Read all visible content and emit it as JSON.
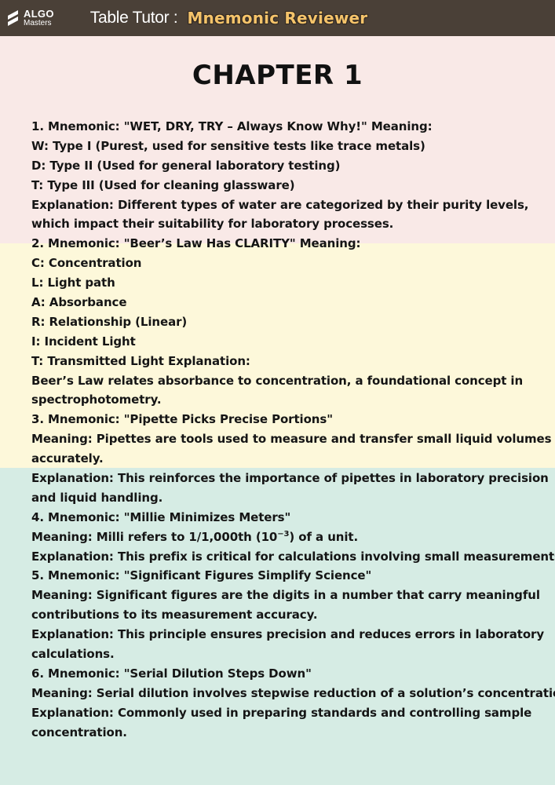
{
  "header": {
    "logo_word": "ALGO",
    "logo_sub": "Masters",
    "title_plain": "Table Tutor :",
    "title_accent": "Mnemonic Reviewer"
  },
  "chapter_title": "CHAPTER 1",
  "lines": [
    "1. Mnemonic: \"WET, DRY, TRY – Always Know Why!\" Meaning:",
    "W: Type I (Purest, used for sensitive tests like trace metals)",
    "D: Type II (Used for general laboratory testing)",
    "T: Type III (Used for cleaning glassware)",
    "Explanation: Different types of water are categorized by their purity levels,",
    "which impact their suitability for laboratory processes.",
    "2. Mnemonic: \"Beer’s Law Has CLARITY\" Meaning:",
    "C: Concentration",
    "L: Light path",
    "A: Absorbance",
    "R: Relationship (Linear)",
    "I: Incident Light",
    "T: Transmitted Light Explanation:",
    "Beer’s Law relates absorbance to concentration, a foundational concept in",
    "spectrophotometry.",
    "3. Mnemonic: \"Pipette Picks Precise Portions\"",
    "Meaning: Pipettes are tools used to measure and transfer small liquid volumes",
    "accurately.",
    "Explanation: This reinforces the importance of pipettes in laboratory precision",
    "and liquid handling.",
    "4. Mnemonic: \"Millie Minimizes Meters\"",
    "",
    "Explanation: This prefix is critical for calculations involving small measurements.",
    "5. Mnemonic: \"Significant Figures Simplify Science\"",
    "Meaning: Significant figures are the digits in a number that carry meaningful",
    "contributions to its measurement accuracy.",
    "Explanation: This principle ensures precision and reduces errors in laboratory",
    "calculations.",
    "6. Mnemonic: \"Serial Dilution Steps Down\"",
    "Meaning: Serial dilution involves stepwise reduction of a solution’s concentration.",
    "Explanation: Commonly used in preparing standards and controlling sample",
    "concentration."
  ],
  "milli_line": {
    "before": "Meaning: Milli refers to 1/1,000th (10",
    "exponent": "−3",
    "after": ") of a unit."
  },
  "colors": {
    "header_bg": "#4a4037",
    "accent_title": "#f4c36a",
    "section_pink": "#f9e9e7",
    "section_yellow": "#fdf8da",
    "section_teal": "#d6ece4"
  }
}
